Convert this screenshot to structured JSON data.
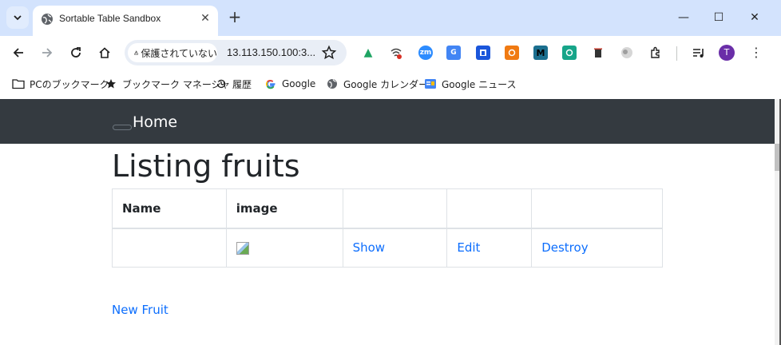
{
  "browser": {
    "tab_title": "Sortable Table Sandbox",
    "security_label": "保護されていない",
    "url": "13.113.150.100:3...",
    "avatar_letter": "T",
    "window_controls": {
      "minimize": "—",
      "maximize": "☐",
      "close": "✕"
    },
    "new_tab": "+",
    "tab_close": "✕",
    "extensions": [
      {
        "name": "google-drive-icon",
        "color": "#1fa463",
        "glyph": "▲"
      },
      {
        "name": "wifi-icon",
        "color": "#ffffff",
        "glyph": ""
      },
      {
        "name": "zoom-icon",
        "color": "#2d8cff",
        "glyph": "zm"
      },
      {
        "name": "translate-icon",
        "color": "#4285f4",
        "glyph": "G"
      },
      {
        "name": "extension-blue-icon",
        "color": "#1a56db",
        "glyph": ""
      },
      {
        "name": "extension-orange-icon",
        "color": "#f07a12",
        "glyph": ""
      },
      {
        "name": "extension-m-icon",
        "color": "#1b6f8f",
        "glyph": "M"
      },
      {
        "name": "extension-green-icon",
        "color": "#17a589",
        "glyph": ""
      },
      {
        "name": "trash-icon",
        "color": "#c0392b",
        "glyph": ""
      },
      {
        "name": "extension-gray-icon",
        "color": "#bdbdbd",
        "glyph": ""
      }
    ]
  },
  "bookmarks": [
    {
      "label": "PCのブックマーク",
      "icon": "folder-icon"
    },
    {
      "label": "ブックマーク マネージャ",
      "icon": "star-icon"
    },
    {
      "label": "履歴",
      "icon": "history-icon"
    },
    {
      "label": "Google",
      "icon": "google-icon"
    },
    {
      "label": "Google カレンダー",
      "icon": "globe-icon"
    },
    {
      "label": "Google ニュース",
      "icon": "google-news-icon"
    }
  ],
  "page": {
    "nav_brand": "Home",
    "title": "Listing fruits",
    "table": {
      "headers": [
        "Name",
        "image",
        "",
        "",
        ""
      ],
      "rows": [
        {
          "name": "",
          "actions": [
            "Show",
            "Edit",
            "Destroy"
          ]
        }
      ]
    },
    "new_link": "New Fruit"
  }
}
